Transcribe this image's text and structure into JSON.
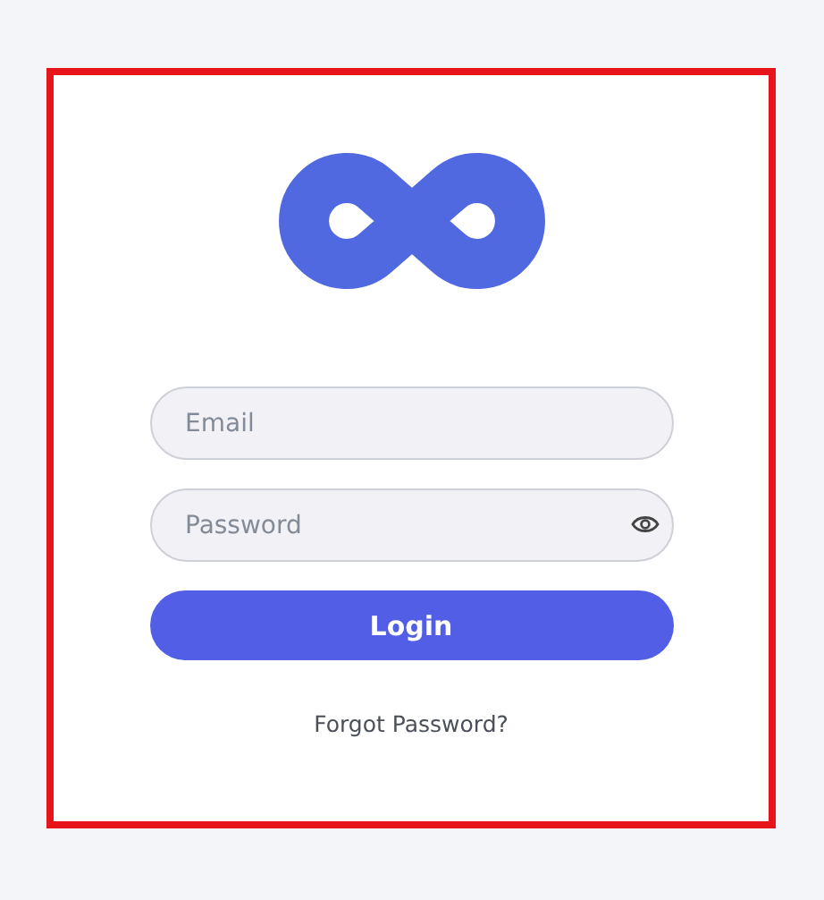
{
  "login_form": {
    "email": {
      "placeholder": "Email"
    },
    "password": {
      "placeholder": "Password"
    },
    "submit": "Login",
    "forgot_link": "Forgot Password?"
  }
}
